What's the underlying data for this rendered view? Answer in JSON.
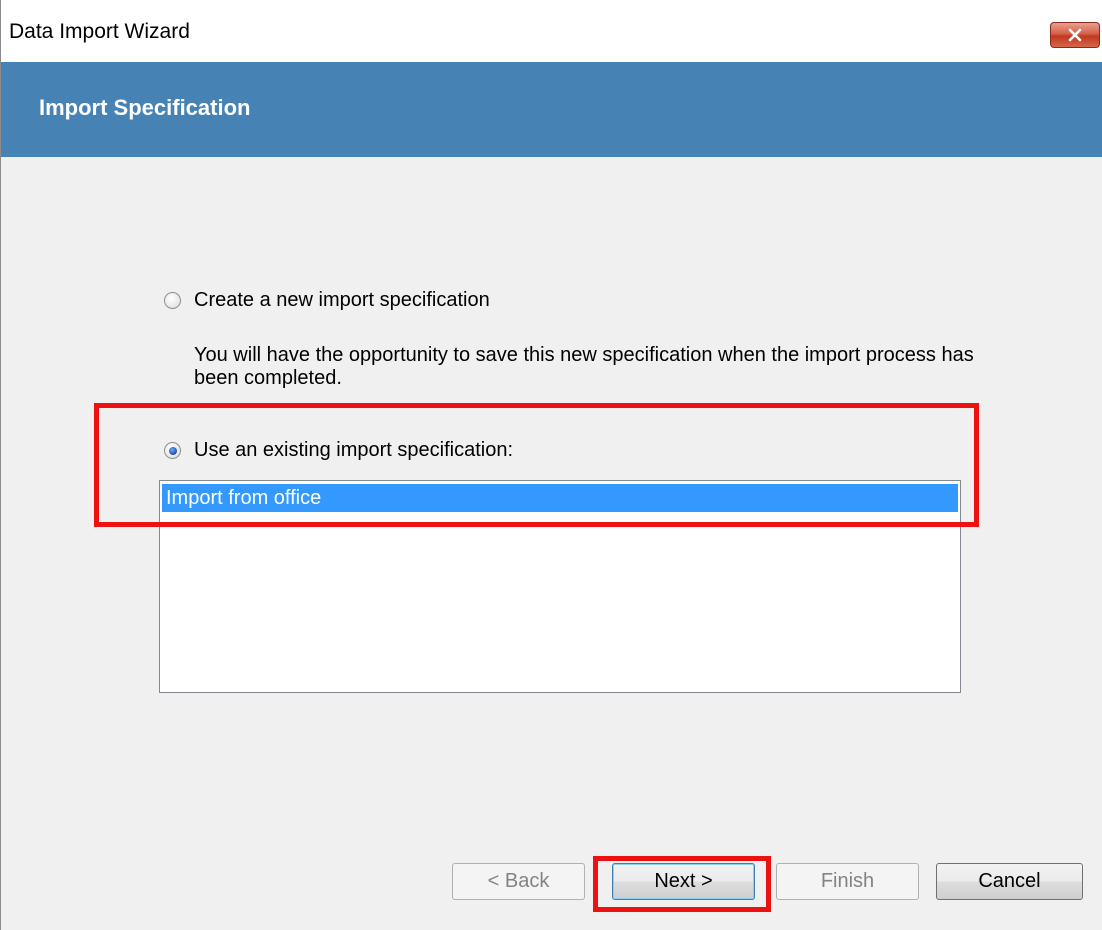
{
  "window": {
    "title": "Data Import Wizard"
  },
  "header": {
    "title": "Import Specification"
  },
  "options": {
    "new_spec": {
      "label": "Create a new import specification",
      "checked": false,
      "description": "You will have the opportunity to save this new specification when the import process has been completed."
    },
    "existing_spec": {
      "label": "Use an existing import specification:",
      "checked": true
    }
  },
  "spec_list": {
    "items": [
      "Import from office"
    ],
    "selected_index": 0
  },
  "buttons": {
    "back": "< Back",
    "next": "Next >",
    "finish": "Finish",
    "cancel": "Cancel"
  },
  "colors": {
    "header_band": "#4682b4",
    "selection": "#3399ff",
    "highlight": "#ee1111"
  },
  "icons": {
    "close": "close-icon"
  }
}
